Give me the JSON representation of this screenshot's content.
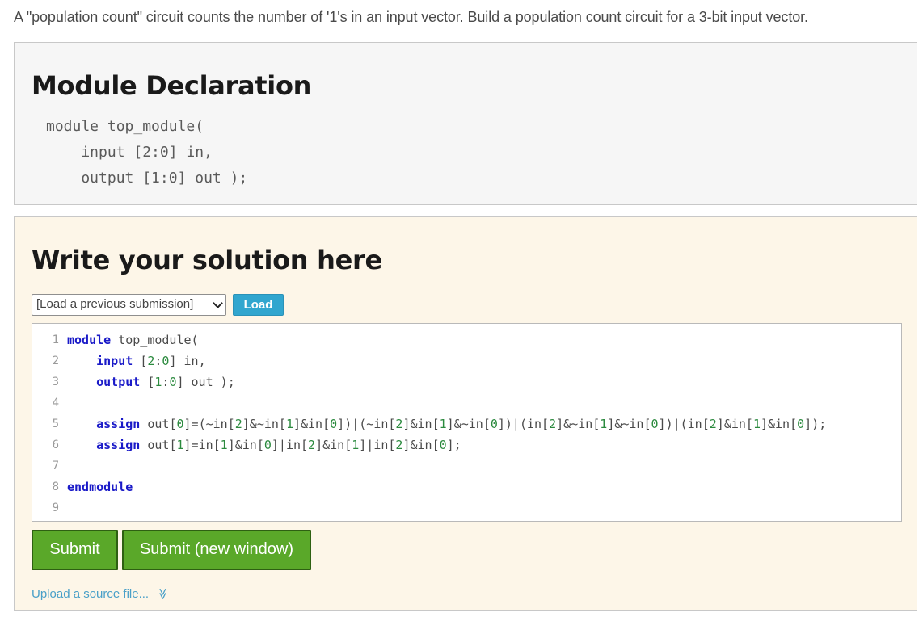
{
  "intro_text": "A \"population count\" circuit counts the number of '1's in an input vector. Build a population count circuit for a 3-bit input vector.",
  "module_declaration": {
    "heading": "Module Declaration",
    "code_lines": [
      "module top_module(",
      "    input [2:0] in,",
      "    output [1:0] out );"
    ]
  },
  "solution": {
    "heading": "Write your solution here",
    "load_select_value": "[Load a previous submission]",
    "load_button_label": "Load",
    "line_numbers": [
      "1",
      "2",
      "3",
      "4",
      "5",
      "6",
      "7",
      "8",
      "9"
    ],
    "code_lines": [
      "module top_module(",
      "    input [2:0] in,",
      "    output [1:0] out );",
      "",
      "    assign out[0]=(~in[2]&~in[1]&in[0])|(~in[2]&in[1]&~in[0])|(in[2]&~in[1]&~in[0])|(in[2]&in[1]&in[0]);",
      "    assign out[1]=in[1]&in[0]|in[2]&in[1]|in[2]&in[0];",
      "",
      "endmodule",
      ""
    ],
    "keywords": [
      "module",
      "input",
      "output",
      "assign",
      "endmodule"
    ],
    "submit_label": "Submit",
    "submit_new_window_label": "Submit (new window)",
    "upload_link_label": "Upload a source file...",
    "upload_icon_char": "≫"
  },
  "colors": {
    "decl_bg": "#f6f6f6",
    "solution_bg": "#fdf6e8",
    "load_button": "#31a6cf",
    "submit_button": "#5aa829",
    "link": "#4aa0c8",
    "keyword": "#1a1ac8",
    "number": "#2b8a3e"
  }
}
